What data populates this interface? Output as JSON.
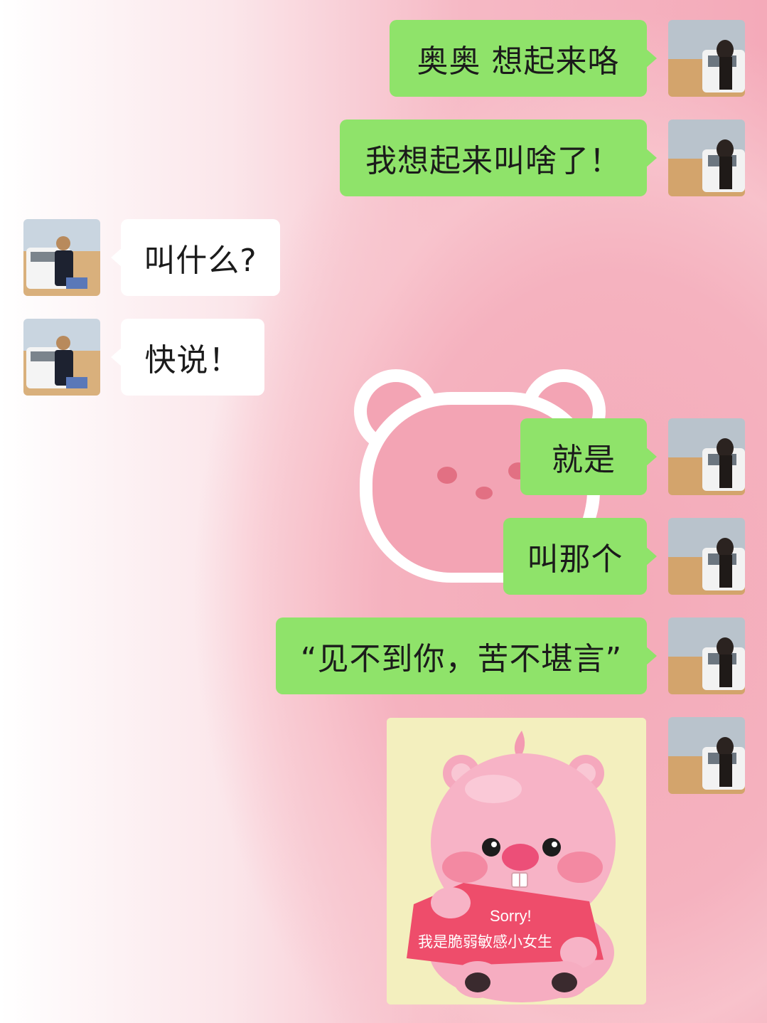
{
  "messages": [
    {
      "side": "me",
      "text": "奥奥  想起来咯"
    },
    {
      "side": "me",
      "text": "我想起来叫啥了！"
    },
    {
      "side": "them",
      "text": "叫什么?"
    },
    {
      "side": "them",
      "text": "快说！"
    },
    {
      "side": "me",
      "text": "就是"
    },
    {
      "side": "me",
      "text": "叫那个"
    },
    {
      "side": "me",
      "text": "“见不到你，苦不堪言”"
    },
    {
      "side": "me",
      "type": "sticker",
      "line1": "Sorry!",
      "line2": "我是脆弱敏感小女生"
    }
  ],
  "colors": {
    "my_bubble": "#8fe36a",
    "their_bubble": "#ffffff",
    "background_pink": "#f4aab9",
    "sticker_bg": "#f3efbe",
    "sticker_banner": "#ee4d6b"
  },
  "icons": {
    "my_avatar": "avatar-woman-by-car-icon",
    "their_avatar": "avatar-man-by-car-icon",
    "background": "pink-bear-outline-icon"
  }
}
